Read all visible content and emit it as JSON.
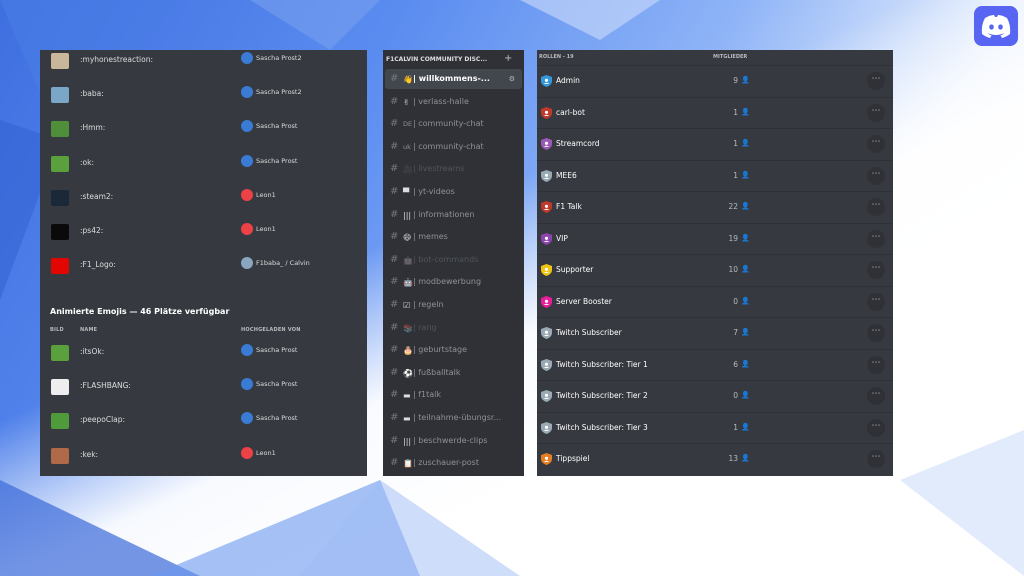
{
  "emoji_panel": {
    "static_emojis": [
      {
        "name": ":myhonestreaction:",
        "uploader": "Sascha Prost2",
        "img": "#c9b79c",
        "avatar": "#3a7bd5"
      },
      {
        "name": ":baba:",
        "uploader": "Sascha Prost2",
        "img": "#7aa7c7",
        "avatar": "#3a7bd5"
      },
      {
        "name": ":Hmm:",
        "uploader": "Sascha Prost",
        "img": "#4f8f3a",
        "avatar": "#3a7bd5"
      },
      {
        "name": ":ok:",
        "uploader": "Sascha Prost",
        "img": "#5aa03c",
        "avatar": "#3a7bd5"
      },
      {
        "name": ":steam2:",
        "uploader": "Leon1",
        "img": "#1b2838",
        "avatar": "#ed4245"
      },
      {
        "name": ":ps42:",
        "uploader": "Leon1",
        "img": "#0a0a0a",
        "avatar": "#ed4245"
      },
      {
        "name": ":F1_Logo:",
        "uploader": "F1baba_ / Calvin",
        "img": "#e10600",
        "avatar": "#8aa6c1"
      }
    ],
    "animated_section_title": "Animierte Emojis — 46 Plätze verfügbar",
    "headers": {
      "image": "BILD",
      "name": "NAME",
      "uploaded_by": "HOCHGELADEN VON"
    },
    "animated_emojis": [
      {
        "name": ":itsOk:",
        "uploader": "Sascha Prost",
        "img": "#5aa03c",
        "avatar": "#3a7bd5"
      },
      {
        "name": ":FLASHBANG:",
        "uploader": "Sascha Prost",
        "img": "#eeeeee",
        "avatar": "#3a7bd5"
      },
      {
        "name": ":peepoClap:",
        "uploader": "Sascha Prost",
        "img": "#4f9a3a",
        "avatar": "#3a7bd5"
      },
      {
        "name": ":kek:",
        "uploader": "Leon1",
        "img": "#b06a4a",
        "avatar": "#ed4245"
      }
    ]
  },
  "channel_panel": {
    "server_name": "F1CALVIN COMMUNITY DISC...",
    "plus_icon": "+",
    "channels": [
      {
        "icon": "👋",
        "name": "| willkommens-...",
        "selected": true,
        "muted": false
      },
      {
        "icon": "✌",
        "name": "| verlass-halle",
        "selected": false,
        "muted": false
      },
      {
        "icon": "DE",
        "name": "| community-chat",
        "selected": false,
        "muted": false
      },
      {
        "icon": "uk",
        "name": "| community-chat",
        "selected": false,
        "muted": false
      },
      {
        "icon": "🎥",
        "name": "| livestreams",
        "selected": false,
        "muted": true
      },
      {
        "icon": "▀",
        "name": "| yt-videos",
        "selected": false,
        "muted": false
      },
      {
        "icon": "|||",
        "name": "| informationen",
        "selected": false,
        "muted": false
      },
      {
        "icon": "😄",
        "name": "| memes",
        "selected": false,
        "muted": false
      },
      {
        "icon": "🤖",
        "name": "| bot-commands",
        "selected": false,
        "muted": true
      },
      {
        "icon": "🤖",
        "name": "| modbewerbung",
        "selected": false,
        "muted": false
      },
      {
        "icon": "☑",
        "name": "| regeln",
        "selected": false,
        "muted": false
      },
      {
        "icon": "📚",
        "name": "| rang",
        "selected": false,
        "muted": true
      },
      {
        "icon": "🎂",
        "name": "| geburtstage",
        "selected": false,
        "muted": false
      },
      {
        "icon": "⚽",
        "name": "| fußballtalk",
        "selected": false,
        "muted": false
      },
      {
        "icon": "▬",
        "name": "| f1talk",
        "selected": false,
        "muted": false
      },
      {
        "icon": "▬",
        "name": "| teilnahme-übungsr...",
        "selected": false,
        "muted": false
      },
      {
        "icon": "|||",
        "name": "| beschwerde-clips",
        "selected": false,
        "muted": false
      },
      {
        "icon": "📋",
        "name": "| zuschauer-post",
        "selected": false,
        "muted": false
      }
    ]
  },
  "roles_panel": {
    "header_roles": "ROLLEN - 19",
    "header_members": "MITGLIEDER",
    "roles": [
      {
        "name": "Admin",
        "count": "9",
        "color": "#3498db"
      },
      {
        "name": "carl-bot",
        "count": "1",
        "color": "#c0392b"
      },
      {
        "name": "Streamcord",
        "count": "1",
        "color": "#9b59b6"
      },
      {
        "name": "MEE6",
        "count": "1",
        "color": "#99aab5"
      },
      {
        "name": "F1 Talk",
        "count": "22",
        "color": "#c0392b"
      },
      {
        "name": "VIP",
        "count": "19",
        "color": "#8e44ad"
      },
      {
        "name": "Supporter",
        "count": "10",
        "color": "#f1c40f"
      },
      {
        "name": "Server Booster",
        "count": "0",
        "color": "#e91e9c"
      },
      {
        "name": "Twitch Subscriber",
        "count": "7",
        "color": "#99aab5"
      },
      {
        "name": "Twitch Subscriber: Tier 1",
        "count": "6",
        "color": "#99aab5"
      },
      {
        "name": "Twitch Subscriber: Tier 2",
        "count": "0",
        "color": "#99aab5"
      },
      {
        "name": "Twitch Subscriber: Tier 3",
        "count": "1",
        "color": "#99aab5"
      },
      {
        "name": "Tippspiel",
        "count": "13",
        "color": "#e67e22"
      }
    ]
  },
  "icons": {
    "more": "⋯",
    "person": "👤",
    "hash": "#"
  }
}
